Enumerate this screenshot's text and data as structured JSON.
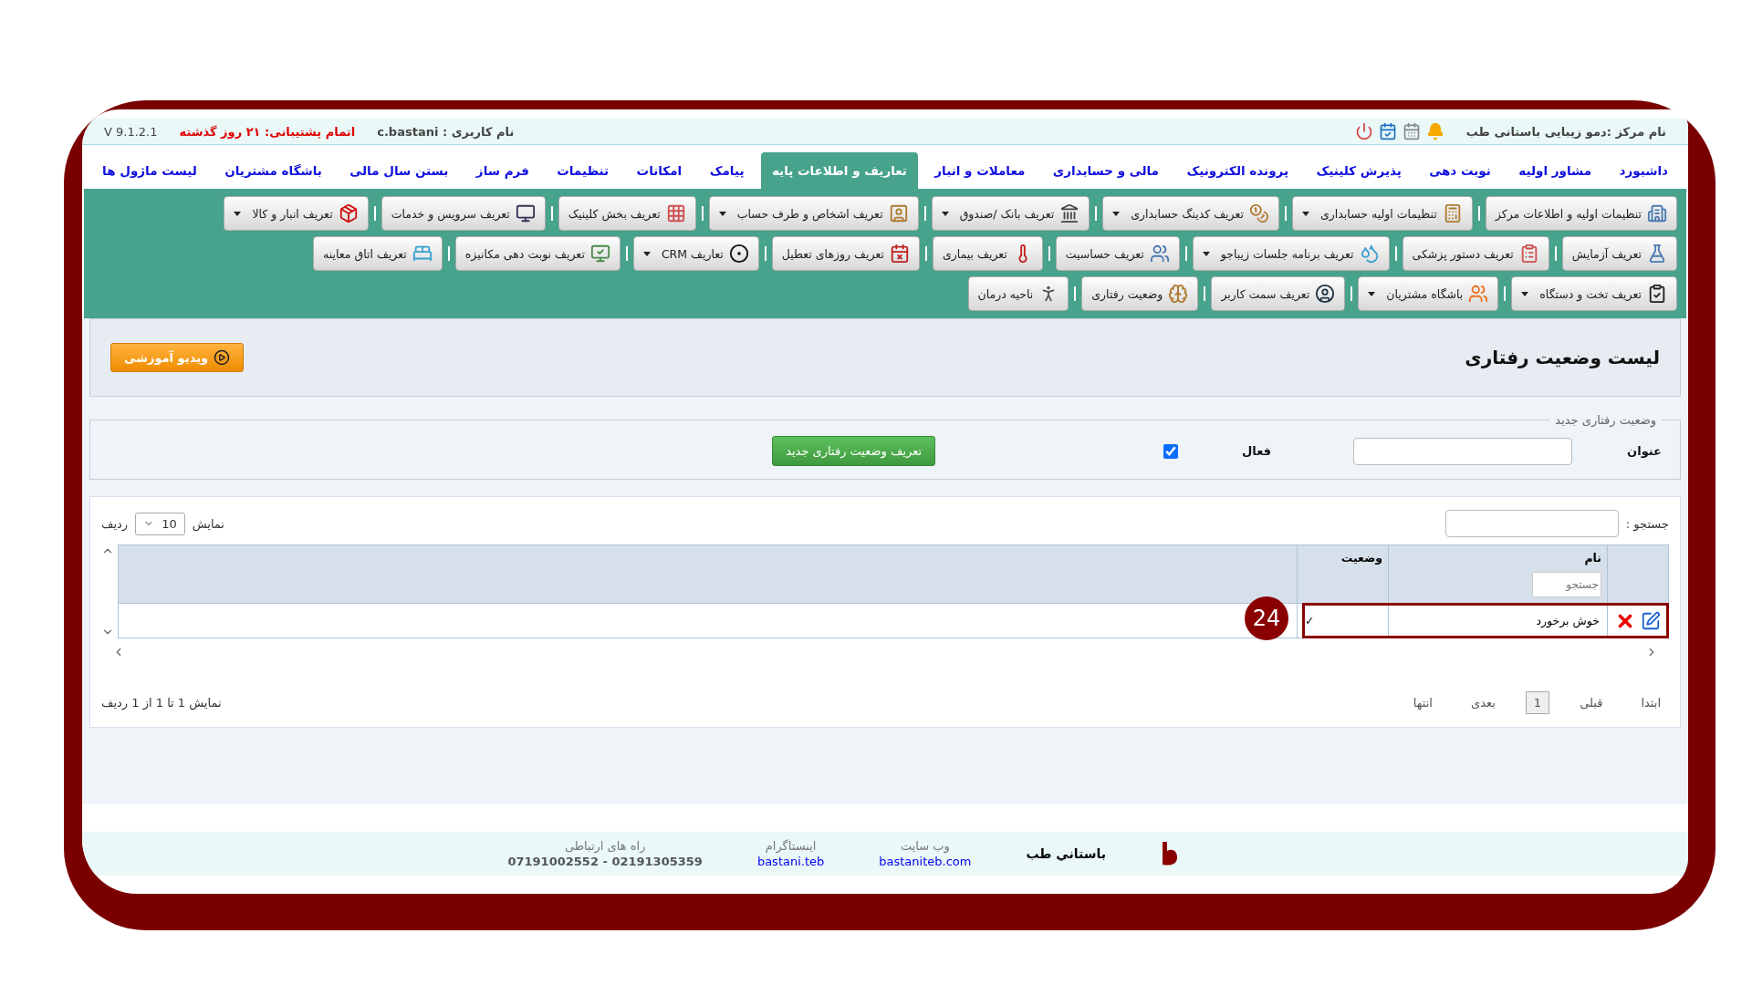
{
  "top_bar": {
    "center_name": "نام مرکز :دمو زیبایی باستانی طب",
    "user": "نام کاربری : c.bastani",
    "support": "اتمام پشتیبانی: ۲۱ روز گذشته",
    "version": "V 9.1.2.1"
  },
  "nav": [
    {
      "label": "داشبورد",
      "selected": false
    },
    {
      "label": "مشاور اولیه",
      "selected": false
    },
    {
      "label": "نوبت دهی",
      "selected": false
    },
    {
      "label": "پذیرش کلینیک",
      "selected": false
    },
    {
      "label": "پرونده الکترونیک",
      "selected": false
    },
    {
      "label": "مالی و حسابداری",
      "selected": false
    },
    {
      "label": "معاملات و انبار",
      "selected": false
    },
    {
      "label": "تعاریف و اطلاعات پایه",
      "selected": true
    },
    {
      "label": "پیامک",
      "selected": false
    },
    {
      "label": "امکانات",
      "selected": false
    },
    {
      "label": "تنظیمات",
      "selected": false
    },
    {
      "label": "فرم ساز",
      "selected": false
    },
    {
      "label": "بستن سال مالی",
      "selected": false
    },
    {
      "label": "باشگاه مشتریان",
      "selected": false
    },
    {
      "label": "لیست ماژول ها",
      "selected": false
    }
  ],
  "toolbar": {
    "rows": [
      {
        "buttons": [
          {
            "label": "تنظیمات اولیه و اطلاعات مرکز",
            "dropdown": false
          },
          {
            "label": "تنظیمات اولیه حسابداری",
            "dropdown": true
          },
          {
            "label": "تعریف کدینگ حسابداری",
            "dropdown": true
          },
          {
            "label": "تعریف بانک /صندوق",
            "dropdown": true
          },
          {
            "label": "تعریف اشخاص و طرف حساب",
            "dropdown": true
          },
          {
            "label": "تعریف بخش کلینیک",
            "dropdown": false
          },
          {
            "label": "تعریف سرویس و خدمات",
            "dropdown": false
          },
          {
            "label": "تعریف انبار و کالا",
            "dropdown": true
          }
        ]
      },
      {
        "buttons": [
          {
            "label": "تعریف آزمایش",
            "dropdown": false
          },
          {
            "label": "تعریف دستور پزشکی",
            "dropdown": false
          },
          {
            "label": "تعریف برنامه جلسات زیباجو",
            "dropdown": true
          },
          {
            "label": "تعریف حساسیت",
            "dropdown": false
          },
          {
            "label": "تعریف بیماری",
            "dropdown": false
          },
          {
            "label": "تعریف روزهای تعطیل",
            "dropdown": false
          },
          {
            "label": "تعاریف CRM",
            "dropdown": true
          },
          {
            "label": "تعریف نوبت دهی مکانیزه",
            "dropdown": false
          },
          {
            "label": "تعریف اتاق معاینه",
            "dropdown": false
          }
        ]
      },
      {
        "buttons": [
          {
            "label": "تعریف تخت و دستگاه",
            "dropdown": true
          },
          {
            "label": "باشگاه مشتریان",
            "dropdown": true
          },
          {
            "label": "تعریف سمت کاربر",
            "dropdown": false
          },
          {
            "label": "وضعیت رفتاری",
            "dropdown": false
          },
          {
            "label": "ناحیه درمان",
            "dropdown": false
          }
        ]
      }
    ]
  },
  "page": {
    "title": "لیست وضعیت رفتاری",
    "video_button": "ویدیو آموزشی"
  },
  "form": {
    "legend": "وضعیت رفتاری جدید",
    "title_label": "عنوان",
    "active_label": "فعال",
    "active_checked": true,
    "submit": "تعریف وضعیت رفتاری جدید"
  },
  "table": {
    "search_label": "جستجو :",
    "show_label": "نمایش",
    "page_size": "10",
    "rows_label": "ردیف",
    "columns": [
      {
        "label": "نام",
        "filter_placeholder": "جستجو"
      },
      {
        "label": "وضعیت"
      }
    ],
    "rows": [
      {
        "name": "خوش برخورد",
        "status": "✓",
        "highlighted": true
      }
    ],
    "pagination": [
      {
        "label": "ابتدا",
        "selected": false
      },
      {
        "label": "قبلی",
        "selected": false
      },
      {
        "label": "1",
        "selected": true
      },
      {
        "label": "بعدی",
        "selected": false
      },
      {
        "label": "انتها",
        "selected": false
      }
    ],
    "info": "نمایش 1 تا 1 از 1 ردیف"
  },
  "annotation": {
    "badge": "24"
  },
  "footer": {
    "brand": "باستاني طب",
    "links": [
      {
        "title": "وب سایت",
        "value": "bastaniteb.com",
        "kind": "link"
      },
      {
        "title": "اینستاگرام",
        "value": "bastani.teb",
        "kind": "link"
      },
      {
        "title": "راه های ارتباطی",
        "value": "07191002552 - 02191305359",
        "kind": "text"
      }
    ]
  }
}
